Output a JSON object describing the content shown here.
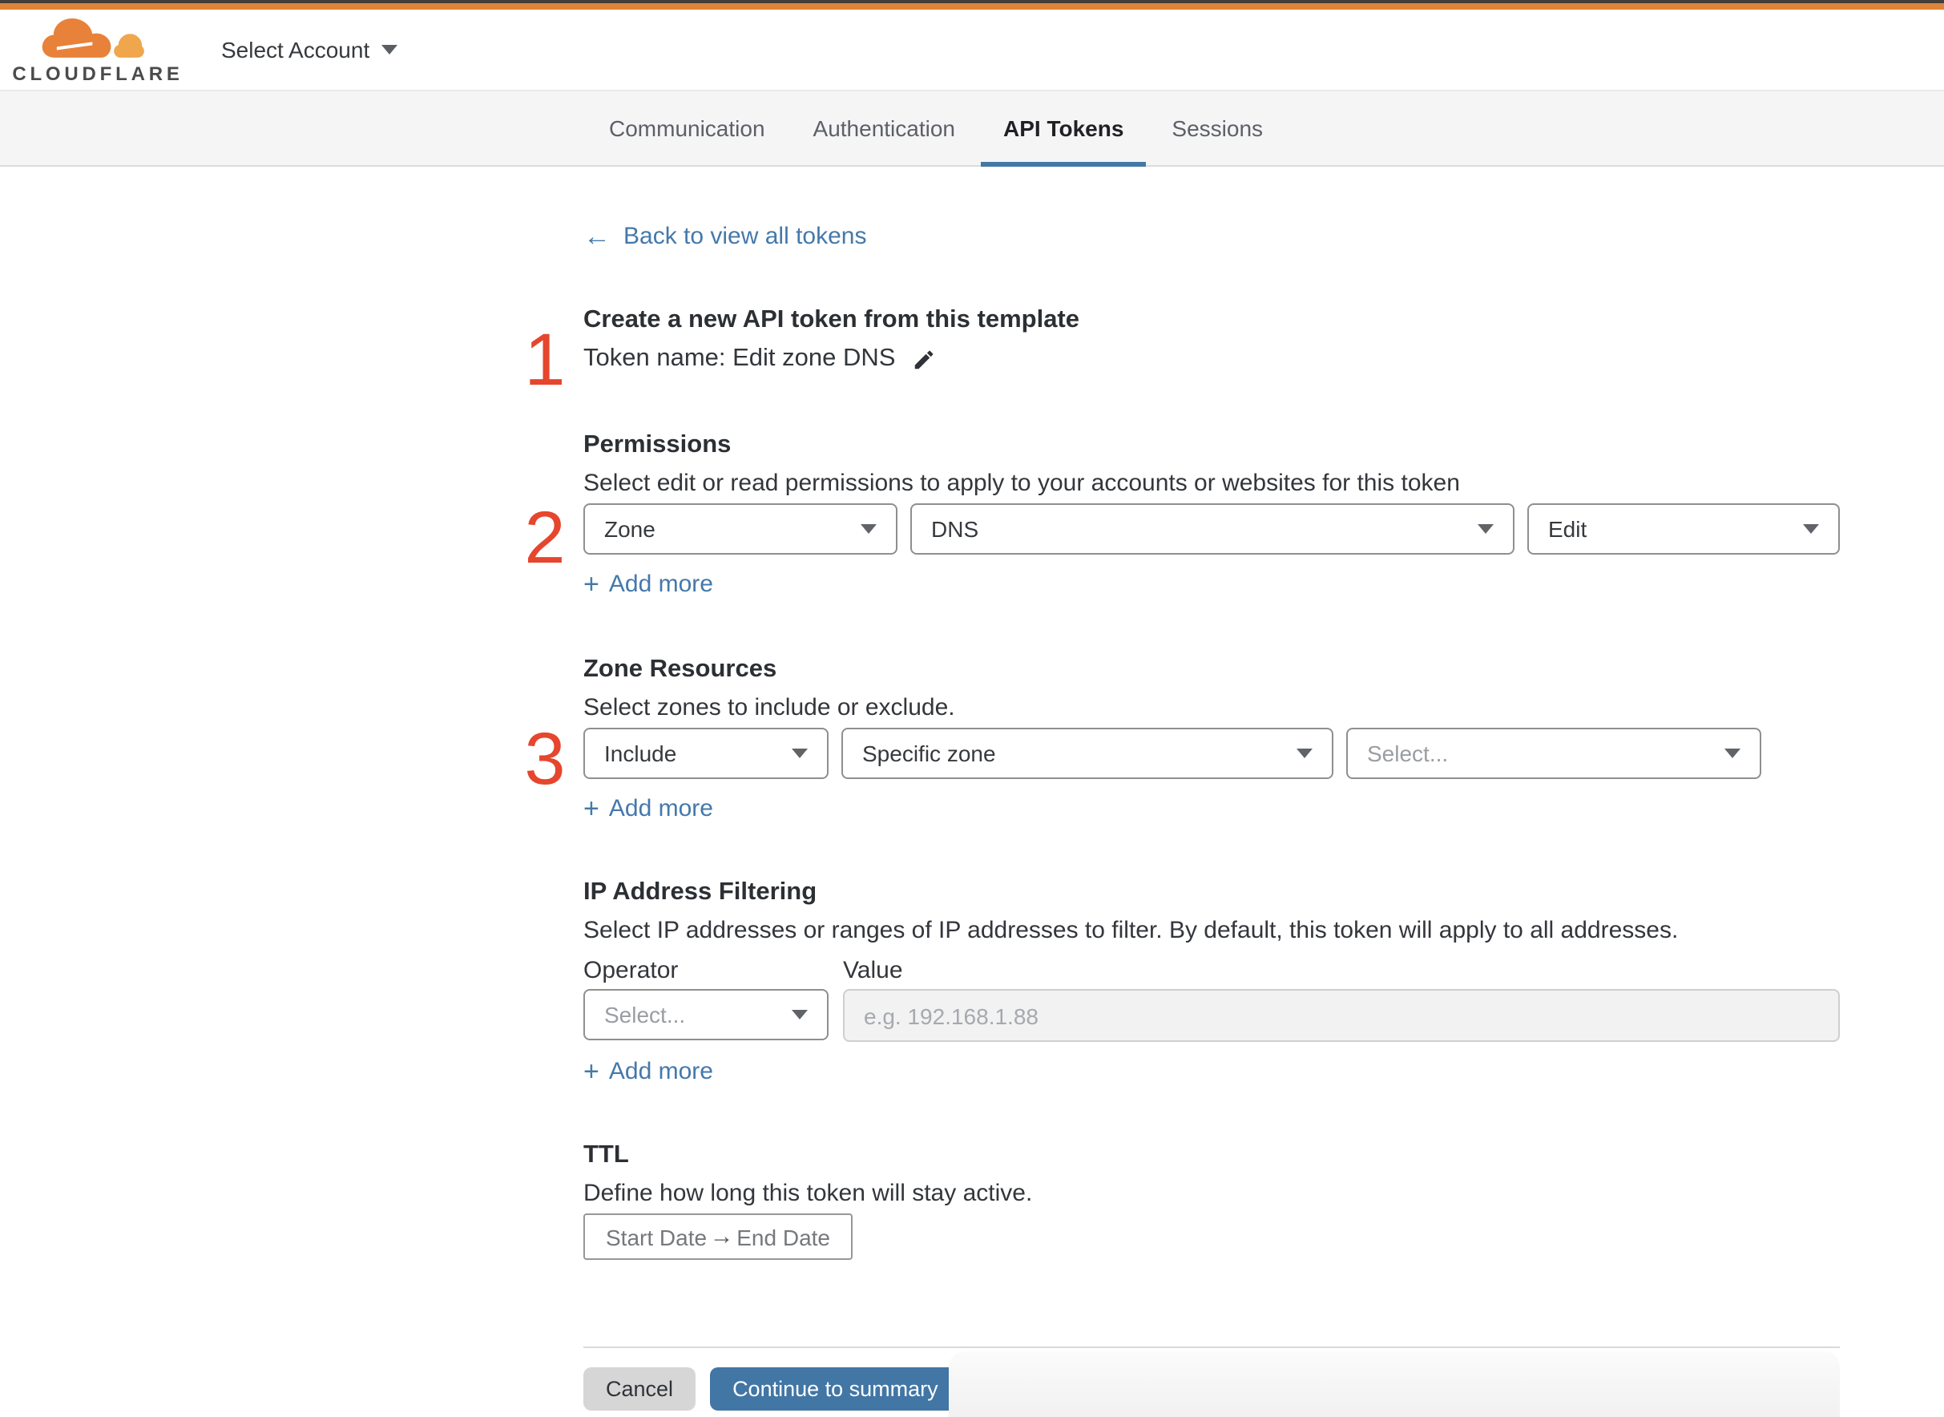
{
  "header": {
    "logo_text": "CLOUDFLARE",
    "account_selector": "Select Account"
  },
  "tabs": [
    {
      "label": "Communication",
      "active": false
    },
    {
      "label": "Authentication",
      "active": false
    },
    {
      "label": "API Tokens",
      "active": true
    },
    {
      "label": "Sessions",
      "active": false
    }
  ],
  "back_link": {
    "arrow": "←",
    "label": "Back to view all tokens"
  },
  "steps": {
    "one": "1",
    "two": "2",
    "three": "3"
  },
  "token": {
    "heading": "Create a new API token from this template",
    "name_line": "Token name: Edit zone DNS"
  },
  "permissions": {
    "heading": "Permissions",
    "description": "Select edit or read permissions to apply to your accounts or websites for this token",
    "scope_value": "Zone",
    "resource_value": "DNS",
    "access_value": "Edit",
    "add_more": "Add more",
    "plus": "+"
  },
  "zone_resources": {
    "heading": "Zone Resources",
    "description": "Select zones to include or exclude.",
    "mode_value": "Include",
    "type_value": "Specific zone",
    "zone_placeholder": "Select...",
    "add_more": "Add more",
    "plus": "+"
  },
  "ip_filtering": {
    "heading": "IP Address Filtering",
    "description": "Select IP addresses or ranges of IP addresses to filter. By default, this token will apply to all addresses.",
    "operator_label": "Operator",
    "value_label": "Value",
    "operator_placeholder": "Select...",
    "value_placeholder": "e.g. 192.168.1.88",
    "add_more": "Add more",
    "plus": "+"
  },
  "ttl": {
    "heading": "TTL",
    "description": "Define how long this token will stay active.",
    "start_label": "Start Date",
    "arrow": "→",
    "end_label": "End Date"
  },
  "footer": {
    "cancel_label": "Cancel",
    "continue_label": "Continue to summary"
  },
  "colors": {
    "brand_orange": "#de8438",
    "brand_orange_light": "#f0a64c",
    "link_blue": "#4479ab",
    "accent_blue": "#4176a5",
    "tab_underline": "#4478a6",
    "step_red": "#e5462d"
  }
}
